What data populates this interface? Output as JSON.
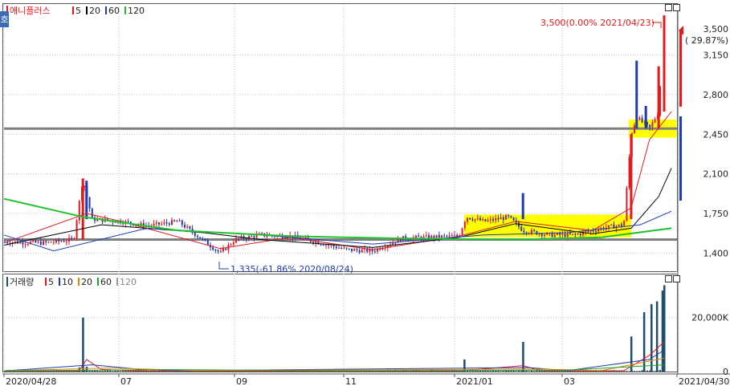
{
  "price_panel": {
    "stock_name": "애니플러스",
    "ma_legend": [
      {
        "label": "5",
        "color": "#e31a1c"
      },
      {
        "label": "20",
        "color": "#000000"
      },
      {
        "label": "60",
        "color": "#1f3bb3"
      },
      {
        "label": "120",
        "color": "#22c22e"
      }
    ],
    "side_tab_label": "호",
    "current_price_label": "3,500",
    "current_change_label": "( 29.87%)",
    "high_annotation": "3,500(0.00% 2021/04/23)",
    "low_annotation": "1,335(-61.86% 2020/08/24)"
  },
  "volume_panel": {
    "title": "거래량",
    "ma_legend": [
      {
        "label": "5",
        "color": "#e31a1c"
      },
      {
        "label": "10",
        "color": "#1f3bb3"
      },
      {
        "label": "20",
        "color": "#d98c00"
      },
      {
        "label": "60",
        "color": "#22a02e"
      },
      {
        "label": "120",
        "color": "#9a9a9a"
      }
    ]
  },
  "x_axis_labels": [
    "2020/04/28",
    "07",
    "09",
    "11",
    "2021/01",
    "03",
    "2021/04/30"
  ],
  "colors": {
    "up": "#e31a1c",
    "down": "#1f3bb3",
    "highlight": "#ffff00",
    "hline": "#808080",
    "volume": "#1f4e6b"
  },
  "chart_data": [
    {
      "type": "candlestick",
      "title": "애니플러스",
      "y_ticks": [
        1400,
        1750,
        2100,
        2450,
        2800,
        3150,
        3500
      ],
      "y_tick_labels": [
        "1,400",
        "1,750",
        "2,100",
        "2,450",
        "2,800",
        "3,150",
        "3,500"
      ],
      "ylim": [
        1240,
        3600
      ],
      "x_range": [
        "2020/04/28",
        "2021/04/30"
      ],
      "horizontal_lines": [
        2500,
        1520
      ],
      "high": {
        "value": 3500,
        "date": "2021/04/23"
      },
      "low": {
        "value": 1335,
        "date": "2020/08/24"
      },
      "close_series": [
        {
          "x": "2020/04/28",
          "y": 1500
        },
        {
          "x": "2020/05/20",
          "y": 1490
        },
        {
          "x": "2020/06/05",
          "y": 1520
        },
        {
          "x": "2020/06/10",
          "y": 2060
        },
        {
          "x": "2020/06/15",
          "y": 1700
        },
        {
          "x": "2020/07/01",
          "y": 1680
        },
        {
          "x": "2020/07/15",
          "y": 1640
        },
        {
          "x": "2020/08/01",
          "y": 1680
        },
        {
          "x": "2020/08/24",
          "y": 1400
        },
        {
          "x": "2020/09/01",
          "y": 1520
        },
        {
          "x": "2020/09/15",
          "y": 1560
        },
        {
          "x": "2020/10/01",
          "y": 1550
        },
        {
          "x": "2020/10/15",
          "y": 1500
        },
        {
          "x": "2020/11/01",
          "y": 1430
        },
        {
          "x": "2020/11/15",
          "y": 1420
        },
        {
          "x": "2020/12/01",
          "y": 1530
        },
        {
          "x": "2020/12/15",
          "y": 1540
        },
        {
          "x": "2021/01/01",
          "y": 1550
        },
        {
          "x": "2021/01/05",
          "y": 1720
        },
        {
          "x": "2021/01/15",
          "y": 1680
        },
        {
          "x": "2021/01/28",
          "y": 1720
        },
        {
          "x": "2021/02/05",
          "y": 1600
        },
        {
          "x": "2021/02/20",
          "y": 1560
        },
        {
          "x": "2021/03/05",
          "y": 1560
        },
        {
          "x": "2021/03/20",
          "y": 1620
        },
        {
          "x": "2021/04/01",
          "y": 1650
        },
        {
          "x": "2021/04/05",
          "y": 2450
        },
        {
          "x": "2021/04/08",
          "y": 2600
        },
        {
          "x": "2021/04/15",
          "y": 2500
        },
        {
          "x": "2021/04/20",
          "y": 2650
        },
        {
          "x": "2021/04/23",
          "y": 3500
        },
        {
          "x": "2021/04/30",
          "y": 3500
        }
      ],
      "moving_averages": [
        {
          "name": "5",
          "values": [
            {
              "x": "2020/04/28",
              "y": 1490
            },
            {
              "x": "2020/06/12",
              "y": 1750
            },
            {
              "x": "2020/07/01",
              "y": 1680
            },
            {
              "x": "2020/08/24",
              "y": 1440
            },
            {
              "x": "2020/10/01",
              "y": 1540
            },
            {
              "x": "2020/11/15",
              "y": 1430
            },
            {
              "x": "2021/01/01",
              "y": 1550
            },
            {
              "x": "2021/02/01",
              "y": 1680
            },
            {
              "x": "2021/03/15",
              "y": 1600
            },
            {
              "x": "2021/04/05",
              "y": 1800
            },
            {
              "x": "2021/04/15",
              "y": 2400
            },
            {
              "x": "2021/04/27",
              "y": 2650
            }
          ]
        },
        {
          "name": "20",
          "values": [
            {
              "x": "2020/04/28",
              "y": 1470
            },
            {
              "x": "2020/06/20",
              "y": 1650
            },
            {
              "x": "2020/08/15",
              "y": 1580
            },
            {
              "x": "2020/09/15",
              "y": 1520
            },
            {
              "x": "2020/11/15",
              "y": 1450
            },
            {
              "x": "2021/01/01",
              "y": 1540
            },
            {
              "x": "2021/02/01",
              "y": 1660
            },
            {
              "x": "2021/03/15",
              "y": 1570
            },
            {
              "x": "2021/04/05",
              "y": 1620
            },
            {
              "x": "2021/04/20",
              "y": 1900
            },
            {
              "x": "2021/04/27",
              "y": 2150
            }
          ]
        },
        {
          "name": "60",
          "values": [
            {
              "x": "2020/04/28",
              "y": 1560
            },
            {
              "x": "2020/05/25",
              "y": 1420
            },
            {
              "x": "2020/07/15",
              "y": 1620
            },
            {
              "x": "2020/09/15",
              "y": 1560
            },
            {
              "x": "2020/11/15",
              "y": 1480
            },
            {
              "x": "2021/01/15",
              "y": 1560
            },
            {
              "x": "2021/03/01",
              "y": 1580
            },
            {
              "x": "2021/04/10",
              "y": 1650
            },
            {
              "x": "2021/04/27",
              "y": 1770
            }
          ]
        },
        {
          "name": "120",
          "values": [
            {
              "x": "2020/04/28",
              "y": 1880
            },
            {
              "x": "2020/06/10",
              "y": 1720
            },
            {
              "x": "2020/08/01",
              "y": 1600
            },
            {
              "x": "2020/10/01",
              "y": 1550
            },
            {
              "x": "2020/12/01",
              "y": 1530
            },
            {
              "x": "2021/02/01",
              "y": 1520
            },
            {
              "x": "2021/03/20",
              "y": 1540
            },
            {
              "x": "2021/04/27",
              "y": 1620
            }
          ]
        }
      ]
    },
    {
      "type": "bar",
      "title": "거래량",
      "y_ticks": [
        0,
        20000
      ],
      "y_tick_labels": [
        "0",
        "20,000K"
      ],
      "ylim": [
        0,
        33000
      ],
      "spikes": [
        {
          "x": "2020/06/08",
          "y": 1500
        },
        {
          "x": "2020/06/10",
          "y": 20000
        },
        {
          "x": "2020/06/12",
          "y": 1800
        },
        {
          "x": "2021/01/04",
          "y": 4500
        },
        {
          "x": "2021/02/05",
          "y": 11000
        },
        {
          "x": "2021/04/05",
          "y": 13000
        },
        {
          "x": "2021/04/12",
          "y": 22000
        },
        {
          "x": "2021/04/16",
          "y": 25000
        },
        {
          "x": "2021/04/19",
          "y": 26000
        },
        {
          "x": "2021/04/22",
          "y": 30000
        },
        {
          "x": "2021/04/23",
          "y": 32000
        }
      ]
    }
  ]
}
